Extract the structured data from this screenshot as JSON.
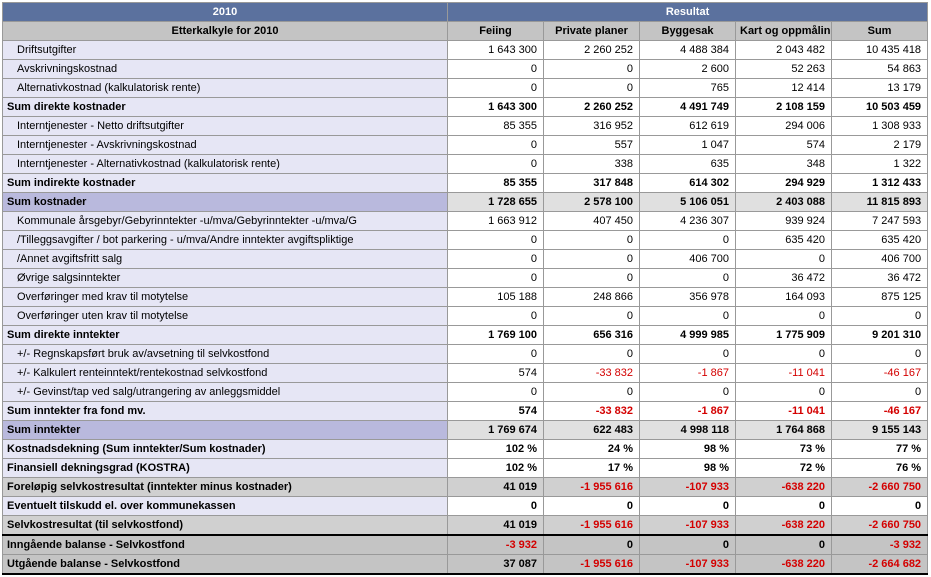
{
  "header": {
    "year": "2010",
    "result": "Resultat",
    "title": "Etterkalkyle for 2010",
    "cols": [
      "Feiing",
      "Private planer",
      "Byggesak",
      "Kart og oppmåling",
      "Sum"
    ]
  },
  "rows": [
    {
      "style": "row-light",
      "indent": true,
      "label": "Driftsutgifter",
      "vals": [
        "1 643 300",
        "2 260 252",
        "4 488 384",
        "2 043 482",
        "10 435 418"
      ],
      "neg": [
        false,
        false,
        false,
        false,
        false
      ]
    },
    {
      "style": "row-light",
      "indent": true,
      "label": "Avskrivningskostnad",
      "vals": [
        "0",
        "0",
        "2 600",
        "52 263",
        "54 863"
      ],
      "neg": [
        false,
        false,
        false,
        false,
        false
      ]
    },
    {
      "style": "row-light",
      "indent": true,
      "label": "Alternativkostnad (kalkulatorisk rente)",
      "vals": [
        "0",
        "0",
        "765",
        "12 414",
        "13 179"
      ],
      "neg": [
        false,
        false,
        false,
        false,
        false
      ]
    },
    {
      "style": "row-bold",
      "indent": false,
      "label": "Sum direkte kostnader",
      "vals": [
        "1 643 300",
        "2 260 252",
        "4 491 749",
        "2 108 159",
        "10 503 459"
      ],
      "neg": [
        false,
        false,
        false,
        false,
        false
      ]
    },
    {
      "style": "row-light",
      "indent": true,
      "label": "Interntjenester - Netto driftsutgifter",
      "vals": [
        "85 355",
        "316 952",
        "612 619",
        "294 006",
        "1 308 933"
      ],
      "neg": [
        false,
        false,
        false,
        false,
        false
      ]
    },
    {
      "style": "row-light",
      "indent": true,
      "label": "Interntjenester - Avskrivningskostnad",
      "vals": [
        "0",
        "557",
        "1 047",
        "574",
        "2 179"
      ],
      "neg": [
        false,
        false,
        false,
        false,
        false
      ]
    },
    {
      "style": "row-light",
      "indent": true,
      "label": "Interntjenester - Alternativkostnad (kalkulatorisk rente)",
      "vals": [
        "0",
        "338",
        "635",
        "348",
        "1 322"
      ],
      "neg": [
        false,
        false,
        false,
        false,
        false
      ]
    },
    {
      "style": "row-bold",
      "indent": false,
      "label": "Sum indirekte kostnader",
      "vals": [
        "85 355",
        "317 848",
        "614 302",
        "294 929",
        "1 312 433"
      ],
      "neg": [
        false,
        false,
        false,
        false,
        false
      ]
    },
    {
      "style": "row-shade",
      "indent": false,
      "label": "Sum kostnader",
      "vals": [
        "1 728 655",
        "2 578 100",
        "5 106 051",
        "2 403 088",
        "11 815 893"
      ],
      "neg": [
        false,
        false,
        false,
        false,
        false
      ]
    },
    {
      "style": "row-light",
      "indent": true,
      "label": "Kommunale årsgebyr/Gebyrinntekter -u/mva/Gebyrinntekter -u/mva/G",
      "vals": [
        "1 663 912",
        "407 450",
        "4 236 307",
        "939 924",
        "7 247 593"
      ],
      "neg": [
        false,
        false,
        false,
        false,
        false
      ]
    },
    {
      "style": "row-light",
      "indent": true,
      "label": "/Tilleggsavgifter / bot parkering - u/mva/Andre inntekter avgiftspliktige",
      "vals": [
        "0",
        "0",
        "0",
        "635 420",
        "635 420"
      ],
      "neg": [
        false,
        false,
        false,
        false,
        false
      ]
    },
    {
      "style": "row-light",
      "indent": true,
      "label": "/Annet avgiftsfritt salg",
      "vals": [
        "0",
        "0",
        "406 700",
        "0",
        "406 700"
      ],
      "neg": [
        false,
        false,
        false,
        false,
        false
      ]
    },
    {
      "style": "row-light",
      "indent": true,
      "label": "Øvrige salgsinntekter",
      "vals": [
        "0",
        "0",
        "0",
        "36 472",
        "36 472"
      ],
      "neg": [
        false,
        false,
        false,
        false,
        false
      ]
    },
    {
      "style": "row-light",
      "indent": true,
      "label": "Overføringer med krav til motytelse",
      "vals": [
        "105 188",
        "248 866",
        "356 978",
        "164 093",
        "875 125"
      ],
      "neg": [
        false,
        false,
        false,
        false,
        false
      ]
    },
    {
      "style": "row-light",
      "indent": true,
      "label": "Overføringer uten krav til motytelse",
      "vals": [
        "0",
        "0",
        "0",
        "0",
        "0"
      ],
      "neg": [
        false,
        false,
        false,
        false,
        false
      ]
    },
    {
      "style": "row-bold",
      "indent": false,
      "label": "Sum direkte inntekter",
      "vals": [
        "1 769 100",
        "656 316",
        "4 999 985",
        "1 775 909",
        "9 201 310"
      ],
      "neg": [
        false,
        false,
        false,
        false,
        false
      ]
    },
    {
      "style": "row-light",
      "indent": true,
      "label": "+/- Regnskapsført bruk av/avsetning til selvkostfond",
      "vals": [
        "0",
        "0",
        "0",
        "0",
        "0"
      ],
      "neg": [
        false,
        false,
        false,
        false,
        false
      ]
    },
    {
      "style": "row-light",
      "indent": true,
      "label": "+/- Kalkulert renteinntekt/rentekostnad selvkostfond",
      "vals": [
        "574",
        "-33 832",
        "-1 867",
        "-11 041",
        "-46 167"
      ],
      "neg": [
        false,
        true,
        true,
        true,
        true
      ]
    },
    {
      "style": "row-light",
      "indent": true,
      "label": "+/- Gevinst/tap ved salg/utrangering av anleggsmiddel",
      "vals": [
        "0",
        "0",
        "0",
        "0",
        "0"
      ],
      "neg": [
        false,
        false,
        false,
        false,
        false
      ]
    },
    {
      "style": "row-bold",
      "indent": false,
      "label": "Sum inntekter fra fond mv.",
      "vals": [
        "574",
        "-33 832",
        "-1 867",
        "-11 041",
        "-46 167"
      ],
      "neg": [
        false,
        true,
        true,
        true,
        true
      ]
    },
    {
      "style": "row-shade",
      "indent": false,
      "label": "Sum inntekter",
      "vals": [
        "1 769 674",
        "622 483",
        "4 998 118",
        "1 764 868",
        "9 155 143"
      ],
      "neg": [
        false,
        false,
        false,
        false,
        false
      ]
    },
    {
      "style": "row-bold",
      "indent": false,
      "label": "Kostnadsdekning (Sum inntekter/Sum kostnader)",
      "vals": [
        "102 %",
        "24 %",
        "98 %",
        "73 %",
        "77 %"
      ],
      "neg": [
        false,
        false,
        false,
        false,
        false
      ]
    },
    {
      "style": "row-bold",
      "indent": false,
      "label": "Finansiell dekningsgrad (KOSTRA)",
      "vals": [
        "102 %",
        "17 %",
        "98 %",
        "72 %",
        "76 %"
      ],
      "neg": [
        false,
        false,
        false,
        false,
        false
      ]
    },
    {
      "style": "row-gray",
      "indent": false,
      "label": "Foreløpig selvkostresultat (inntekter minus kostnader)",
      "vals": [
        "41 019",
        "-1 955 616",
        "-107 933",
        "-638 220",
        "-2 660 750"
      ],
      "neg": [
        false,
        true,
        true,
        true,
        true
      ]
    },
    {
      "style": "row-bold",
      "indent": false,
      "label": "Eventuelt tilskudd el. over kommunekassen",
      "vals": [
        "0",
        "0",
        "0",
        "0",
        "0"
      ],
      "neg": [
        false,
        false,
        false,
        false,
        false
      ]
    },
    {
      "style": "row-gray row-thick-bottom",
      "indent": false,
      "label": "Selvkostresultat (til selvkostfond)",
      "vals": [
        "41 019",
        "-1 955 616",
        "-107 933",
        "-638 220",
        "-2 660 750"
      ],
      "neg": [
        false,
        true,
        true,
        true,
        true
      ]
    },
    {
      "style": "row-final row-thick",
      "indent": false,
      "label": "Inngående balanse - Selvkostfond",
      "vals": [
        "-3 932",
        "0",
        "0",
        "0",
        "-3 932"
      ],
      "neg": [
        true,
        false,
        false,
        false,
        true
      ]
    },
    {
      "style": "row-final row-thick-bottom",
      "indent": false,
      "label": "Utgående balanse - Selvkostfond",
      "vals": [
        "37 087",
        "-1 955 616",
        "-107 933",
        "-638 220",
        "-2 664 682"
      ],
      "neg": [
        false,
        true,
        true,
        true,
        true
      ]
    }
  ]
}
